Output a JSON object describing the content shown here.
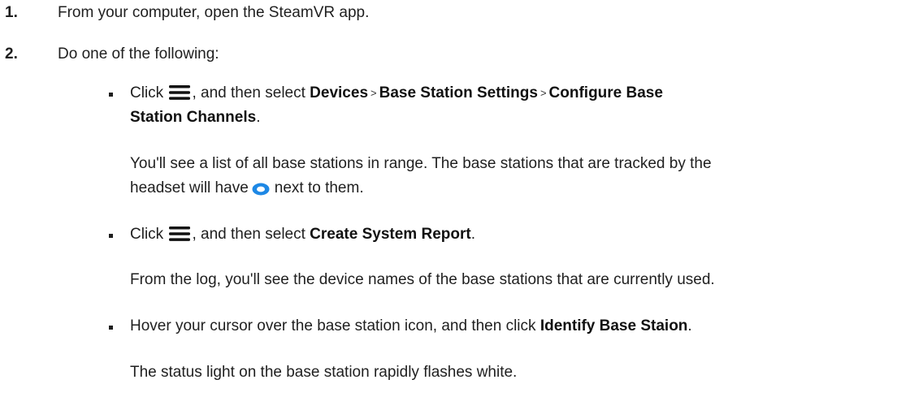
{
  "steps": [
    {
      "number": "1.",
      "text": "From your computer, open the SteamVR app."
    },
    {
      "number": "2.",
      "text": "Do one of the following:"
    }
  ],
  "options": [
    {
      "click": "Click",
      "then": ", and then select",
      "path": [
        "Devices",
        "Base Station Settings",
        "Configure Base"
      ],
      "path_cont": "Station Channels",
      "end": ".",
      "separator": ">",
      "note_line1": "You'll see a list of all base stations in range. The base stations that are tracked by the",
      "note_line2_pre": "headset will have",
      "note_line2_post": "next to them."
    },
    {
      "click": "Click",
      "then": ", and then select",
      "item": "Create System Report",
      "end": ".",
      "note": "From the log, you'll see the device names of the base stations that are currently used."
    },
    {
      "pre": "Hover your cursor over the base station icon, and then click",
      "item": "Identify Base Staion",
      "end": ".",
      "note": "The status light on the base station rapidly flashes white."
    }
  ],
  "icons": {
    "menu": "hamburger-menu-icon",
    "tracked": "eye-icon"
  },
  "colors": {
    "text": "#1f1f1f",
    "eye_icon": "#1e88e5"
  }
}
